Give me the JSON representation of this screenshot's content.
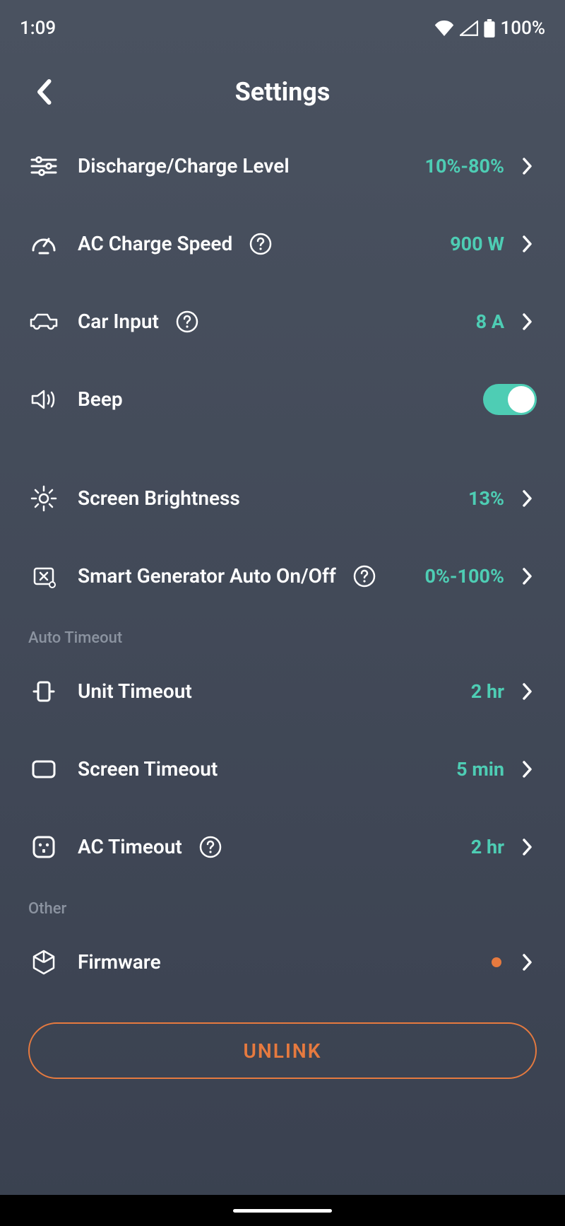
{
  "status": {
    "time": "1:09",
    "battery": "100%"
  },
  "header": {
    "title": "Settings"
  },
  "rows": {
    "discharge": {
      "label": "Discharge/Charge Level",
      "value": "10%-80%"
    },
    "ac_speed": {
      "label": "AC Charge Speed",
      "value": "900 W"
    },
    "car_input": {
      "label": "Car Input",
      "value": "8 A"
    },
    "beep": {
      "label": "Beep",
      "on": true
    },
    "brightness": {
      "label": "Screen Brightness",
      "value": "13%"
    },
    "smartgen": {
      "label": "Smart Generator Auto On/Off",
      "value": "0%-100%"
    },
    "unit_timeout": {
      "label": "Unit Timeout",
      "value": "2 hr"
    },
    "screen_timeout": {
      "label": "Screen Timeout",
      "value": "5 min"
    },
    "ac_timeout": {
      "label": "AC Timeout",
      "value": "2 hr"
    },
    "firmware": {
      "label": "Firmware"
    }
  },
  "sections": {
    "auto_timeout": "Auto Timeout",
    "other": "Other"
  },
  "buttons": {
    "unlink": "UNLINK"
  }
}
